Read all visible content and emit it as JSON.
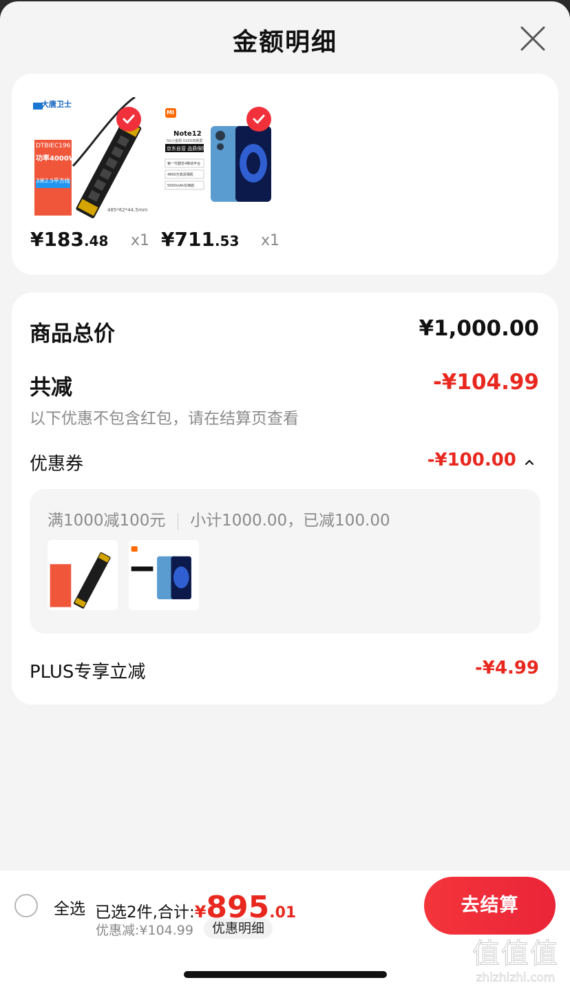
{
  "header": {
    "title": "金额明细"
  },
  "products": [
    {
      "brand": "大唐卫士",
      "model": "DTBIEC196",
      "power": "功率4000W",
      "spec": "3米2.5平方线",
      "dims": "485*62*44.5mm",
      "price_int": "¥183",
      "price_dec": ".48",
      "qty": "x1"
    },
    {
      "brand": "MI",
      "model": "Note12",
      "subtitle": "5G小金刚 OLED高刷屏",
      "badge": "京东自营 品质保障",
      "feat1": "第一代骁龙4移动平台",
      "feat2": "4800万高清相机",
      "feat3": "5000mAh长续航",
      "price_int": "¥711",
      "price_dec": ".53",
      "qty": "x1"
    }
  ],
  "detail": {
    "total_label": "商品总价",
    "total_value": "¥1,000.00",
    "reduce_label": "共减",
    "reduce_value": "-¥104.99",
    "reduce_note": "以下优惠不包含红包，请在结算页查看",
    "coupon_label": "优惠券",
    "coupon_value": "-¥100.00",
    "coupon_rule": "满1000减100元",
    "coupon_subtotal": "小计1000.00，已减100.00",
    "plus_label": "PLUS专享立减",
    "plus_value": "-¥4.99"
  },
  "bottom": {
    "select_all": "全选",
    "summary_prefix": "已选2件,合计:",
    "sum_currency": "¥",
    "sum_int": "895",
    "sum_dec": ".01",
    "discount": "优惠减:¥104.99",
    "detail_link": "优惠明细",
    "checkout": "去结算"
  },
  "watermark": {
    "glyphs": "值值值",
    "url": "zhizhizhi.com"
  },
  "colors": {
    "accent": "#e8281f",
    "button": "#f0313b",
    "background": "#f4f4f4"
  }
}
